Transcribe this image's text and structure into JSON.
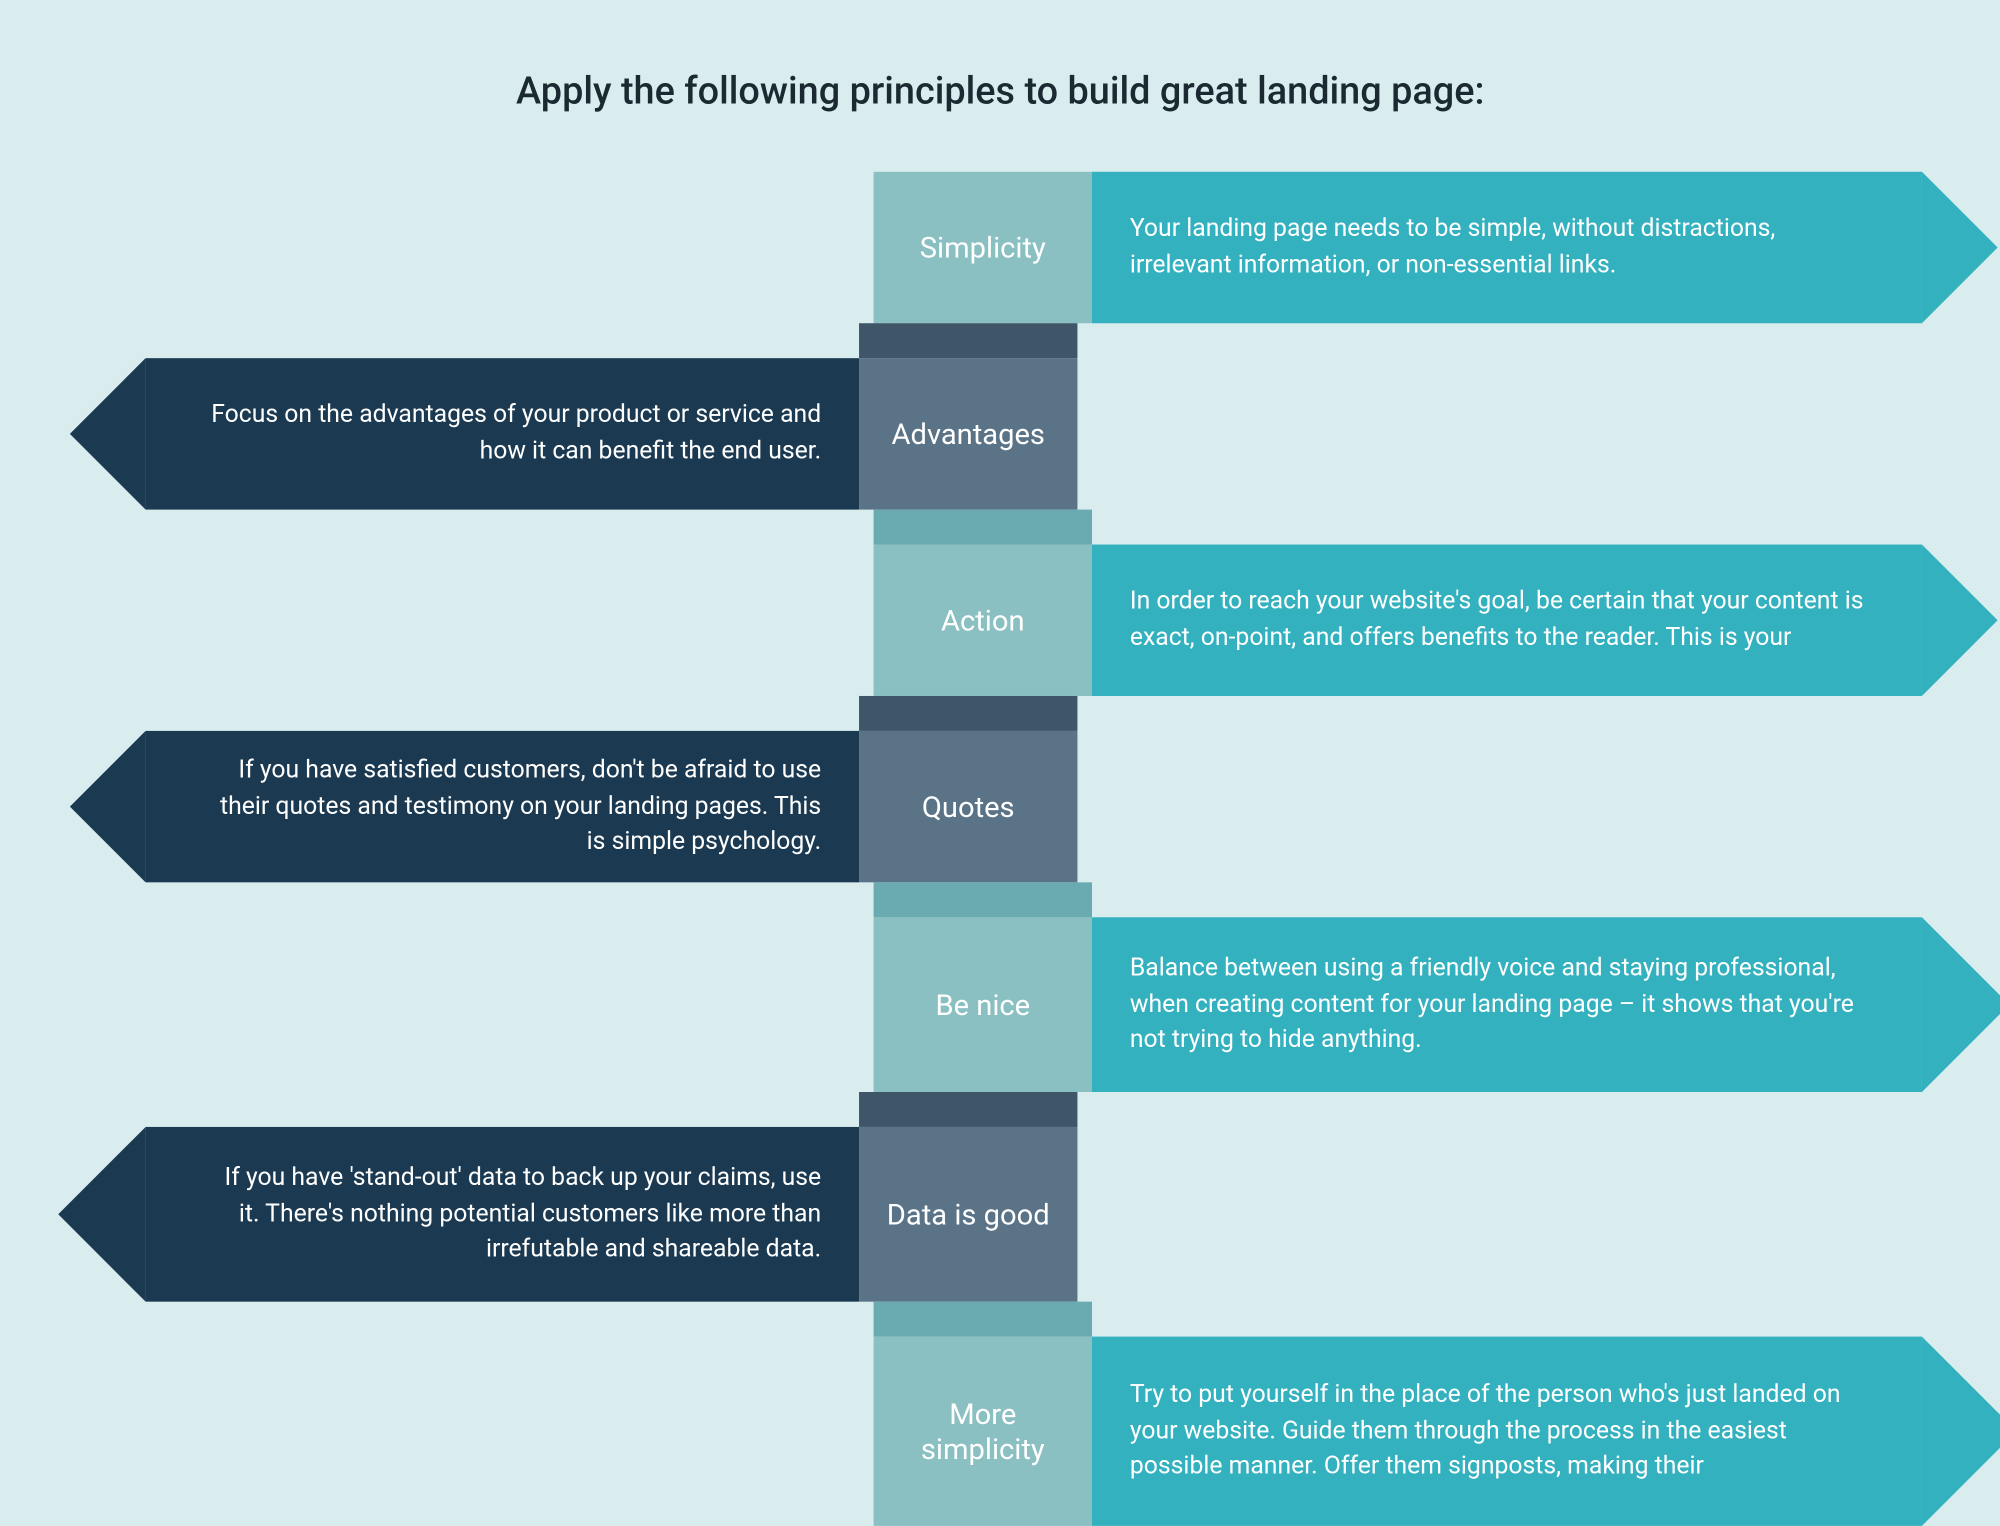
{
  "title": "Apply the following principles to build great landing page:",
  "colors": {
    "bg": "#d9ecee",
    "rightBody": "#33b1bf",
    "leftBody": "#1b3a52",
    "labelLight": "#8bc0c3",
    "labelDark": "#5a7387"
  },
  "rows": [
    {
      "side": "right",
      "label": "Simplicity",
      "text": " Your landing page needs to be simple, without distractions, irrelevant information, or non-essential links."
    },
    {
      "side": "left",
      "label": "Advantages",
      "text": "Focus on the advantages of your product or service and how it can benefit the end user."
    },
    {
      "side": "right",
      "label": "Action",
      "text": "In order to reach your website's goal, be certain that your content is exact, on-point, and offers benefits to the reader. This is your"
    },
    {
      "side": "left",
      "label": "Quotes",
      "text": "If you have satisfied customers, don't be afraid to use their quotes and testimony on your landing pages. This is simple psychology."
    },
    {
      "side": "right",
      "label": "Be nice",
      "text": "Balance between using a friendly voice and staying professional, when creating content for your landing page – it shows that you're not trying to hide anything."
    },
    {
      "side": "left",
      "label": "Data is good",
      "text": "If you have 'stand-out' data to back up your claims, use it. There's nothing potential customers like more than irrefutable and shareable data."
    },
    {
      "side": "right",
      "label": "More simplicity",
      "text": "Try to put yourself in the place of the person who's just landed on your website. Guide them through the process in the easiest possible manner. Offer them signposts, making their"
    }
  ]
}
